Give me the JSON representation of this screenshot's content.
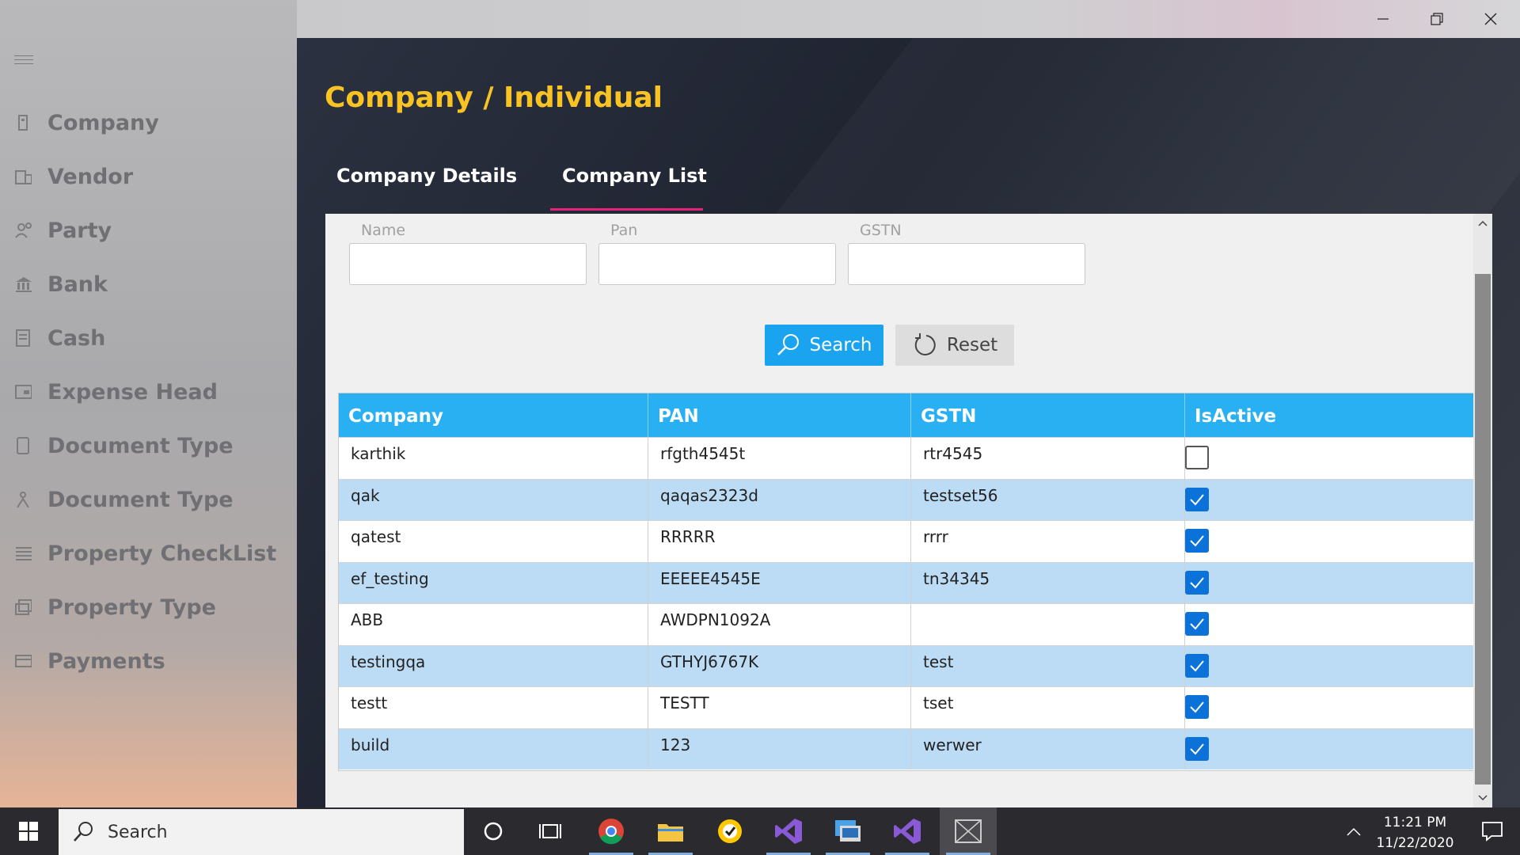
{
  "sidebar": {
    "items": [
      {
        "label": "Company",
        "icon": "building-icon"
      },
      {
        "label": "Vendor",
        "icon": "office-icon"
      },
      {
        "label": "Party",
        "icon": "people-icon"
      },
      {
        "label": "Bank",
        "icon": "bank-icon"
      },
      {
        "label": "Cash",
        "icon": "ledger-icon"
      },
      {
        "label": "Expense Head",
        "icon": "receipt-icon"
      },
      {
        "label": "Document Type",
        "icon": "document-icon"
      },
      {
        "label": "Document Type",
        "icon": "person-icon"
      },
      {
        "label": "Property CheckList",
        "icon": "checklist-icon"
      },
      {
        "label": "Property Type",
        "icon": "property-icon"
      },
      {
        "label": "Payments",
        "icon": "card-icon"
      }
    ]
  },
  "header": {
    "title": "Company / Individual"
  },
  "tabs": [
    {
      "label": "Company Details",
      "selected": false
    },
    {
      "label": "Company List",
      "selected": true
    }
  ],
  "filters": {
    "name_label": "Name",
    "pan_label": "Pan",
    "gstn_label": "GSTN",
    "name_value": "",
    "pan_value": "",
    "gstn_value": ""
  },
  "buttons": {
    "search": "Search",
    "reset": "Reset"
  },
  "table": {
    "columns": [
      "Company",
      "PAN",
      "GSTN",
      "IsActive"
    ],
    "rows": [
      {
        "company": "karthik",
        "pan": "rfgth4545t",
        "gstn": "rtr4545",
        "active": false
      },
      {
        "company": "qak",
        "pan": "qaqas2323d",
        "gstn": "testset56",
        "active": true
      },
      {
        "company": "qatest",
        "pan": "RRRRR",
        "gstn": "rrrr",
        "active": true
      },
      {
        "company": "ef_testing",
        "pan": "EEEEE4545E",
        "gstn": "tn34345",
        "active": true
      },
      {
        "company": "ABB",
        "pan": "AWDPN1092A",
        "gstn": "",
        "active": true
      },
      {
        "company": "testingqa",
        "pan": "GTHYJ6767K",
        "gstn": "test",
        "active": true
      },
      {
        "company": "testt",
        "pan": "TESTT",
        "gstn": "tset",
        "active": true
      },
      {
        "company": "build",
        "pan": "123",
        "gstn": "werwer",
        "active": true
      }
    ]
  },
  "taskbar": {
    "search_label": "Search",
    "time": "11:21 PM",
    "date": "11/22/2020",
    "apps": [
      "cortana-icon",
      "task-view-icon",
      "chrome-icon",
      "file-explorer-icon",
      "norton-icon",
      "visual-studio-icon",
      "remote-desktop-icon",
      "visual-studio-icon",
      "app-window-icon"
    ]
  },
  "colors": {
    "accent": "#f9c423",
    "tab_underline": "#e5237a",
    "header_blue": "#29b0f2",
    "row_alt": "#bcdcf5",
    "checkbox": "#0a72d8"
  }
}
